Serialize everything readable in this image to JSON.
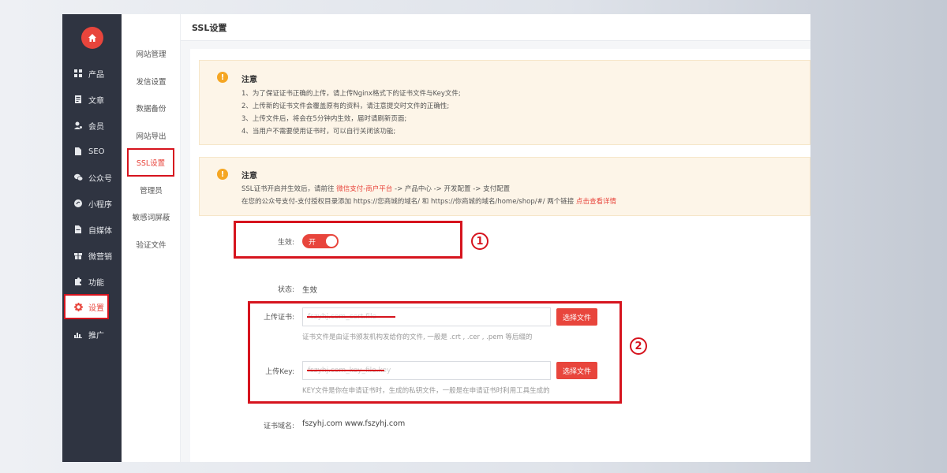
{
  "sidebar": {
    "items": [
      {
        "label": "产品",
        "icon": "grid-icon"
      },
      {
        "label": "文章",
        "icon": "document-icon"
      },
      {
        "label": "会员",
        "icon": "user-icon"
      },
      {
        "label": "SEO",
        "icon": "file-icon"
      },
      {
        "label": "公众号",
        "icon": "wechat-icon"
      },
      {
        "label": "小程序",
        "icon": "miniprogram-icon"
      },
      {
        "label": "自媒体",
        "icon": "media-icon"
      },
      {
        "label": "微营销",
        "icon": "gift-icon"
      },
      {
        "label": "功能",
        "icon": "puzzle-icon"
      },
      {
        "label": "设置",
        "icon": "gear-icon"
      },
      {
        "label": "推广",
        "icon": "chart-icon"
      }
    ]
  },
  "subnav": {
    "items": [
      "网站管理",
      "发信设置",
      "数据备份",
      "网站导出",
      "SSL设置",
      "管理员",
      "敏感词屏蔽",
      "验证文件"
    ]
  },
  "page": {
    "title": "SSL设置"
  },
  "notice1": {
    "title": "注意",
    "lines": [
      "1、为了保证证书正确的上传，请上传Nginx格式下的证书文件与Key文件;",
      "2、上传新的证书文件会覆盖原有的资料，请注意提交时文件的正确性;",
      "3、上传文件后，将会在5分钟内生效，届时请刷新页面;",
      "4、当用户不需要使用证书时，可以自行关闭该功能;"
    ]
  },
  "notice2": {
    "title": "注意",
    "line1_pre": "SSL证书开启并生效后，请前往 ",
    "line1_link": "微信支付-商户平台",
    "line1_post": " -> 产品中心 -> 开发配置 -> 支付配置",
    "line2_pre": "在您的公众号支付-支付授权目录添加 https://您商城的域名/ 和 https://你商城的域名/home/shop/#/ 两个链接 ",
    "line2_link": "点击查看详情"
  },
  "form": {
    "enable_label": "生效:",
    "toggle_text": "开",
    "status_label": "状态:",
    "status_value": "生效",
    "cert_label": "上传证书:",
    "cert_value": "fszyhj.com_cert.file",
    "cert_button": "选择文件",
    "cert_hint": "证书文件是由证书颁发机构发给你的文件, 一般是 .crt , .cer , .pem 等后缀的",
    "key_label": "上传Key:",
    "key_value": "fszyhj.com_key_file.key",
    "key_button": "选择文件",
    "key_hint": "KEY文件是你在申请证书时，生成的私钥文件，一般是在申请证书时利用工具生成的",
    "domain_label": "证书域名:",
    "domain_value": "fszyhj.com www.fszyhj.com"
  },
  "annotations": {
    "one": "1",
    "two": "2"
  },
  "colors": {
    "accent": "#e8453c",
    "sidebar": "#2f3441",
    "notice_bg": "#fdf5e8",
    "annotation": "#d6141e"
  }
}
